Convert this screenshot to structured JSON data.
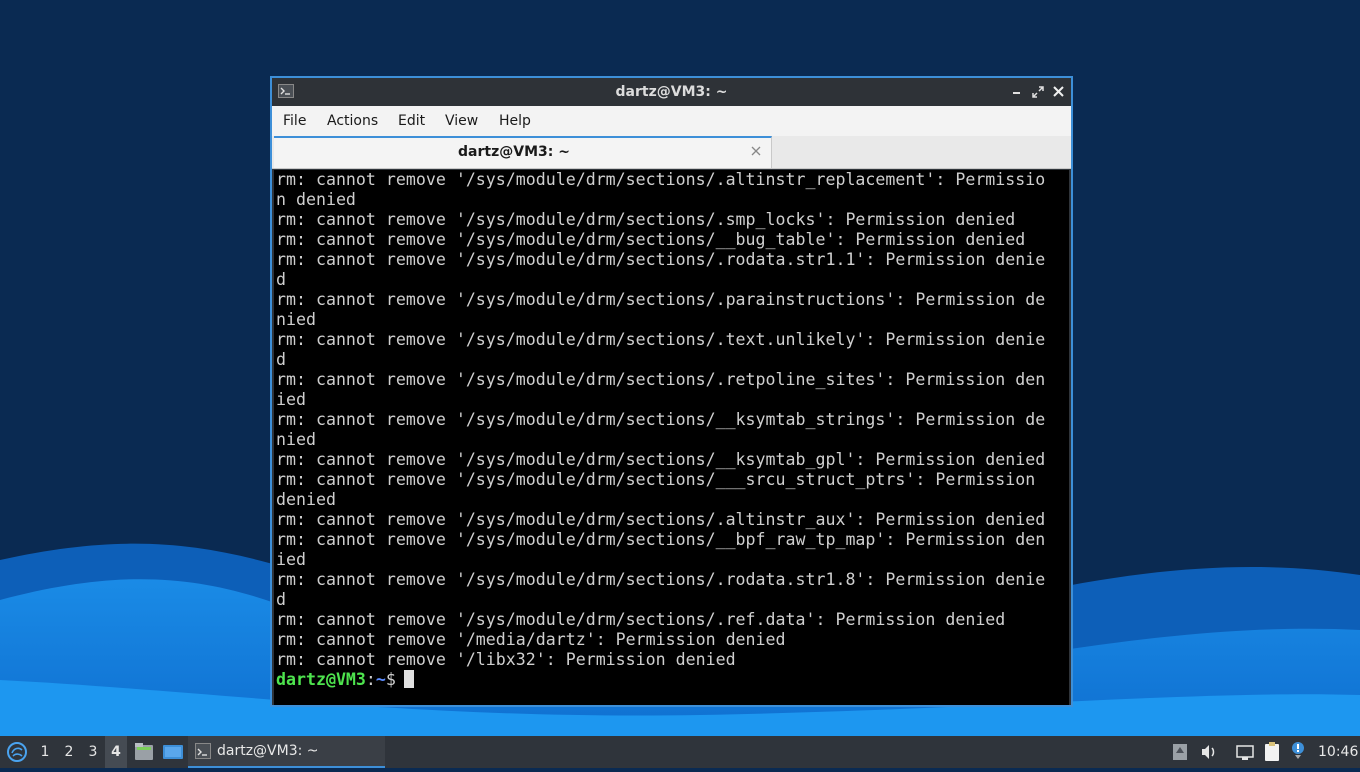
{
  "colors": {
    "accent": "#3d8fd8",
    "prompt_user": "#4ee44e",
    "prompt_path": "#5c8cff",
    "terminal_bg": "#000000",
    "desktop": "#0a2a52"
  },
  "window": {
    "title": "dartz@VM3: ~",
    "icon": "terminal-icon",
    "controls": [
      "minimize-icon",
      "maximize-icon",
      "close-icon"
    ]
  },
  "menu": {
    "file": "File",
    "actions": "Actions",
    "edit": "Edit",
    "view": "View",
    "help": "Help"
  },
  "tab": {
    "label": "dartz@VM3: ~",
    "close_icon": "close-icon"
  },
  "terminal": {
    "lines": [
      "rm: cannot remove '/sys/module/drm/sections/.altinstr_replacement': Permissio",
      "n denied",
      "rm: cannot remove '/sys/module/drm/sections/.smp_locks': Permission denied",
      "rm: cannot remove '/sys/module/drm/sections/__bug_table': Permission denied",
      "rm: cannot remove '/sys/module/drm/sections/.rodata.str1.1': Permission denie",
      "d",
      "rm: cannot remove '/sys/module/drm/sections/.parainstructions': Permission de",
      "nied",
      "rm: cannot remove '/sys/module/drm/sections/.text.unlikely': Permission denie",
      "d",
      "rm: cannot remove '/sys/module/drm/sections/.retpoline_sites': Permission den",
      "ied",
      "rm: cannot remove '/sys/module/drm/sections/__ksymtab_strings': Permission de",
      "nied",
      "rm: cannot remove '/sys/module/drm/sections/__ksymtab_gpl': Permission denied",
      "rm: cannot remove '/sys/module/drm/sections/___srcu_struct_ptrs': Permission",
      "denied",
      "rm: cannot remove '/sys/module/drm/sections/.altinstr_aux': Permission denied",
      "rm: cannot remove '/sys/module/drm/sections/__bpf_raw_tp_map': Permission den",
      "ied",
      "rm: cannot remove '/sys/module/drm/sections/.rodata.str1.8': Permission denie",
      "d",
      "rm: cannot remove '/sys/module/drm/sections/.ref.data': Permission denied",
      "rm: cannot remove '/media/dartz': Permission denied",
      "rm: cannot remove '/libx32': Permission denied"
    ],
    "prompt": {
      "user_host": "dartz@VM3",
      "colon": ":",
      "path": "~",
      "symbol": "$"
    }
  },
  "taskbar": {
    "start_icon": "lubuntu-start-icon",
    "workspaces": [
      "1",
      "2",
      "3",
      "4"
    ],
    "active_workspace": "4",
    "launchers": [
      "file-manager-icon",
      "show-desktop-icon"
    ],
    "task": {
      "label": "dartz@VM3: ~",
      "icon": "terminal-icon"
    },
    "tray": [
      "update-notifier-icon",
      "volume-icon",
      "network-icon",
      "clipboard-icon",
      "notification-icon"
    ],
    "clock": "10:46"
  }
}
